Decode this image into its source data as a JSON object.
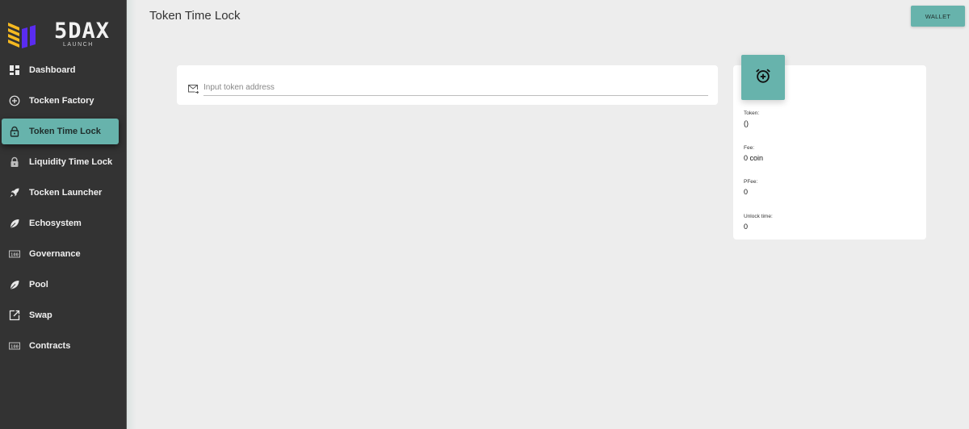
{
  "app": {
    "brand": "5DAX",
    "brand_sub": "LAUNCH",
    "colors": {
      "accent": "#67b3ac",
      "sidebar_bg": "#333333",
      "page_bg": "#ededed",
      "logo_yellow": "#f5b921",
      "logo_purple": "#5a2cf0"
    }
  },
  "sidebar": {
    "items": [
      {
        "label": "Dashboard",
        "icon": "dashboard-icon",
        "active": false
      },
      {
        "label": "Tocken Factory",
        "icon": "plus-circle-icon",
        "active": false
      },
      {
        "label": "Token Time Lock",
        "icon": "lock-icon",
        "active": true
      },
      {
        "label": "Liquidity Time Lock",
        "icon": "lock-icon",
        "active": false
      },
      {
        "label": "Tocken Launcher",
        "icon": "rocket-icon",
        "active": false
      },
      {
        "label": "Echosystem",
        "icon": "leaf-icon",
        "active": false
      },
      {
        "label": "Governance",
        "icon": "counter-icon",
        "active": false
      },
      {
        "label": "Pool",
        "icon": "leaf-icon",
        "active": false
      },
      {
        "label": "Swap",
        "icon": "external-link-icon",
        "active": false
      },
      {
        "label": "Contracts",
        "icon": "counter-icon",
        "active": false
      }
    ]
  },
  "header": {
    "title": "Token Time Lock",
    "wallet_label": "WALLET"
  },
  "form": {
    "token_address": {
      "value": "",
      "placeholder": "Input token address",
      "icon": "mail-forward-icon"
    }
  },
  "info": {
    "icon": "alarm-add-icon",
    "fields": [
      {
        "label": "Token:",
        "value": "()"
      },
      {
        "label": "Fee:",
        "value": "0 coin"
      },
      {
        "label": "PFee:",
        "value": "0"
      },
      {
        "label": "Unlock time:",
        "value": "0"
      }
    ]
  }
}
